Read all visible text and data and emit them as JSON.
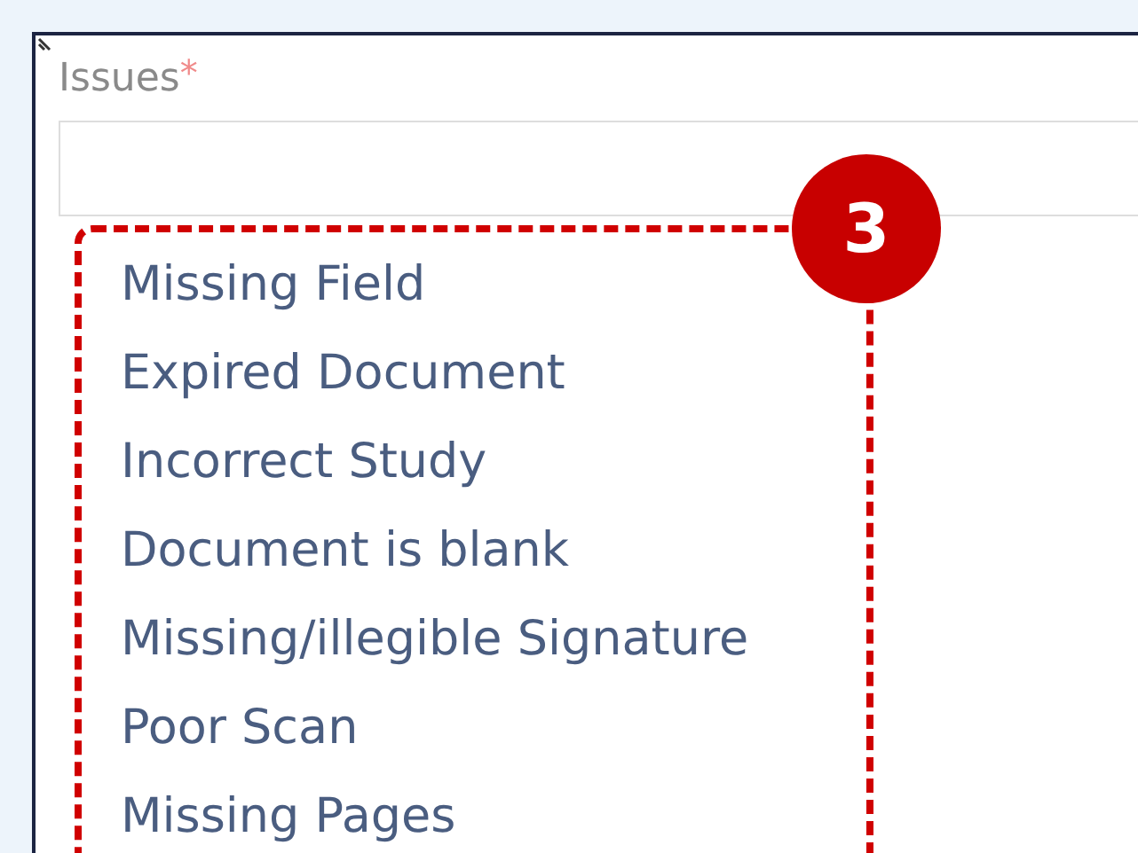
{
  "field": {
    "label": "Issues",
    "required_mark": "*"
  },
  "callout": {
    "number": "3"
  },
  "options": [
    {
      "label": "Missing Field"
    },
    {
      "label": "Expired Document"
    },
    {
      "label": "Incorrect Study"
    },
    {
      "label": "Document is blank"
    },
    {
      "label": "Missing/illegible Signature"
    },
    {
      "label": "Poor Scan"
    },
    {
      "label": "Missing Pages"
    }
  ]
}
